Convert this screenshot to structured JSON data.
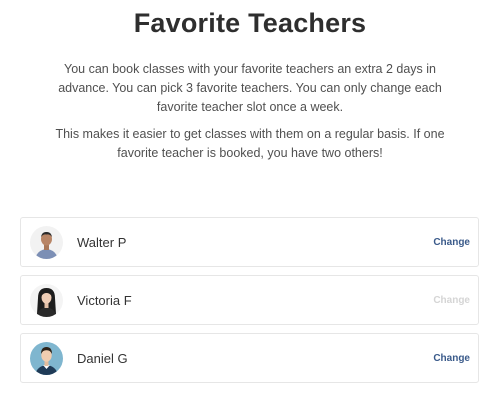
{
  "header": {
    "title": "Favorite Teachers"
  },
  "intro": {
    "paragraph1": "You can book classes with your favorite teachers an extra 2 days in advance. You can pick 3 favorite teachers. You can only change each favorite teacher slot once a week.",
    "paragraph2": "This makes it easier to get classes with them on a regular basis. If one favorite teacher is booked, you have two others!"
  },
  "teachers": [
    {
      "name": "Walter P",
      "change_label": "Change",
      "change_enabled": true,
      "avatar_icon": "avatar-walter"
    },
    {
      "name": "Victoria F",
      "change_label": "Change",
      "change_enabled": false,
      "avatar_icon": "avatar-victoria"
    },
    {
      "name": "Daniel G",
      "change_label": "Change",
      "change_enabled": true,
      "avatar_icon": "avatar-daniel"
    }
  ],
  "colors": {
    "link": "#3a5a8a",
    "disabled": "#d5d5d5",
    "border": "#e6e6e6"
  }
}
